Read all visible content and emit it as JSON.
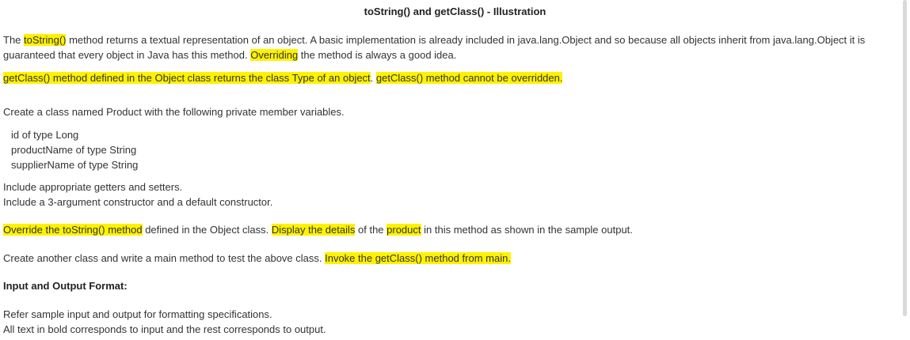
{
  "title": "toString() and getClass() - Illustration",
  "para1": {
    "line1": {
      "t1": "The ",
      "hl1": "toString()",
      "t2": " method returns a textual representation of an object. A basic implementation is already included in java.lang.Object and so because all objects inherit from java.lang.Object it is"
    },
    "line2": {
      "t1": "guaranteed that every object in Java has this method. ",
      "hl1": "Overriding",
      "t2": " the method is always a good idea."
    }
  },
  "para2": {
    "hl1": "getClass() method defined in the Object class returns the class Type of an object",
    "t1": ". ",
    "hl2": "getClass() method cannot be overridden."
  },
  "para3": "Create a class named Product with the following private member variables.",
  "members": [
    "id of type Long",
    "productName of type String",
    "supplierName of type String"
  ],
  "para4": {
    "line1": "Include appropriate getters and setters.",
    "line2": "Include a 3-argument constructor and a default constructor."
  },
  "para5": {
    "hl1": "Override the toString() method",
    "t1": " defined in the Object class. ",
    "hl2": "Display the details",
    "t2": " of the ",
    "hl3": "product",
    "t3": " in this method as shown in the sample output."
  },
  "para6": {
    "t1": "Create another class and write a main method to test the above class. ",
    "hl1": "Invoke the getClass() method from main."
  },
  "section_heading": "Input and Output Format:",
  "para7": {
    "line1": "Refer sample input and output for formatting specifications.",
    "line2": "All text in bold corresponds to input and the rest corresponds to output."
  },
  "colors": {
    "highlight": "#fff200",
    "text": "#333333"
  }
}
